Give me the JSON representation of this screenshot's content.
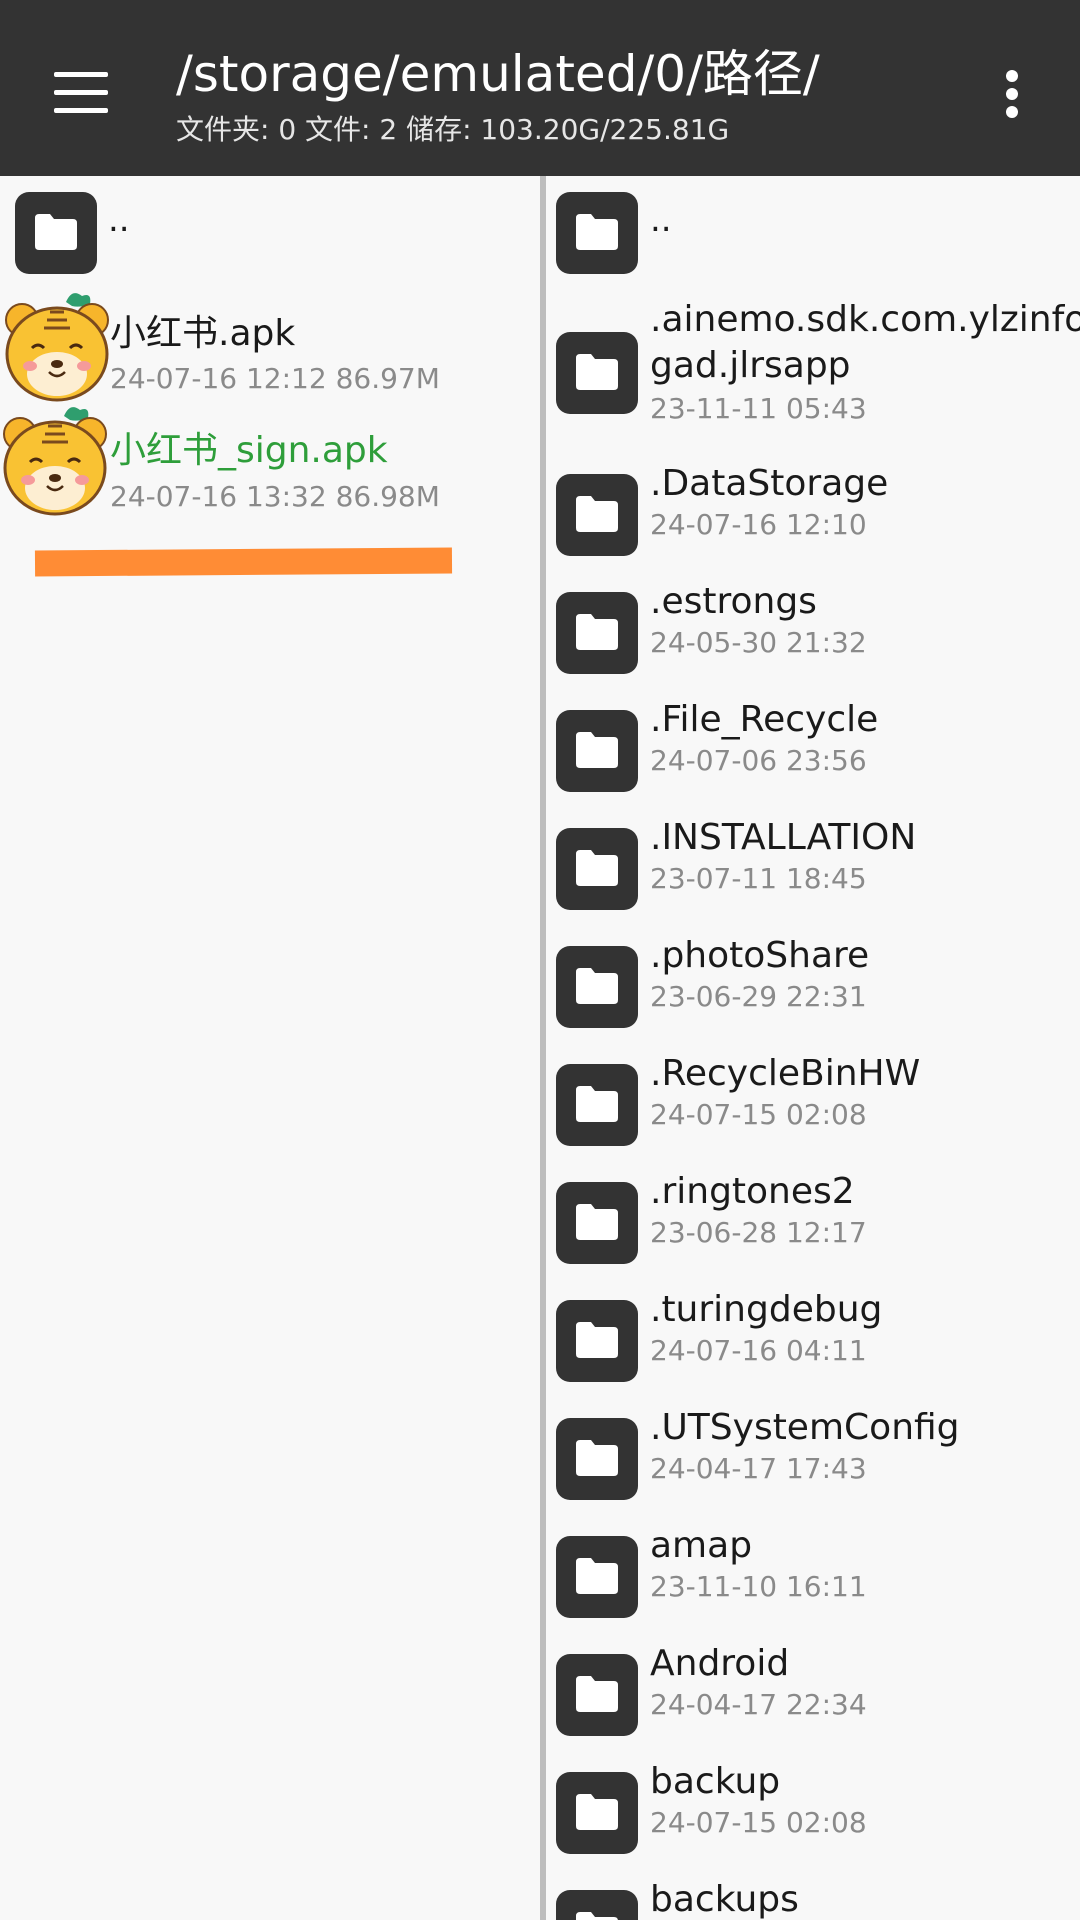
{
  "header": {
    "path": "/storage/emulated/0/路径/",
    "stats": "文件夹: 0  文件: 2  储存: 103.20G/225.81G"
  },
  "colors": {
    "appbar": "#333333",
    "accent_green": "#2e9e3a",
    "highlight_orange": "#ff8c35"
  },
  "left_pane": {
    "parent": "..",
    "files": [
      {
        "name": "小红书.apk",
        "meta": "24-07-16 12:12  86.97M",
        "icon": "tiger-app-icon",
        "selected": false
      },
      {
        "name": "小红书_sign.apk",
        "meta": "24-07-16 13:32  86.98M",
        "icon": "tiger-app-icon",
        "selected": true
      }
    ]
  },
  "right_pane": {
    "parent": "..",
    "folders": [
      {
        "name": ".ainemo.sdk.com.ylzinfo.",
        "name2": "gad.jlrsapp",
        "date": "23-11-11 05:43"
      },
      {
        "name": ".DataStorage",
        "date": "24-07-16 12:10"
      },
      {
        "name": ".estrongs",
        "date": "24-05-30 21:32"
      },
      {
        "name": ".File_Recycle",
        "date": "24-07-06 23:56"
      },
      {
        "name": ".INSTALLATION",
        "date": "23-07-11 18:45"
      },
      {
        "name": ".photoShare",
        "date": "23-06-29 22:31"
      },
      {
        "name": ".RecycleBinHW",
        "date": "24-07-15 02:08"
      },
      {
        "name": ".ringtones2",
        "date": "23-06-28 12:17"
      },
      {
        "name": ".turingdebug",
        "date": "24-07-16 04:11"
      },
      {
        "name": ".UTSystemConfig",
        "date": "24-04-17 17:43"
      },
      {
        "name": "amap",
        "date": "23-11-10 16:11"
      },
      {
        "name": "Android",
        "date": "24-04-17 22:34"
      },
      {
        "name": "backup",
        "date": "24-07-15 02:08"
      },
      {
        "name": "backups",
        "date": ""
      }
    ]
  }
}
